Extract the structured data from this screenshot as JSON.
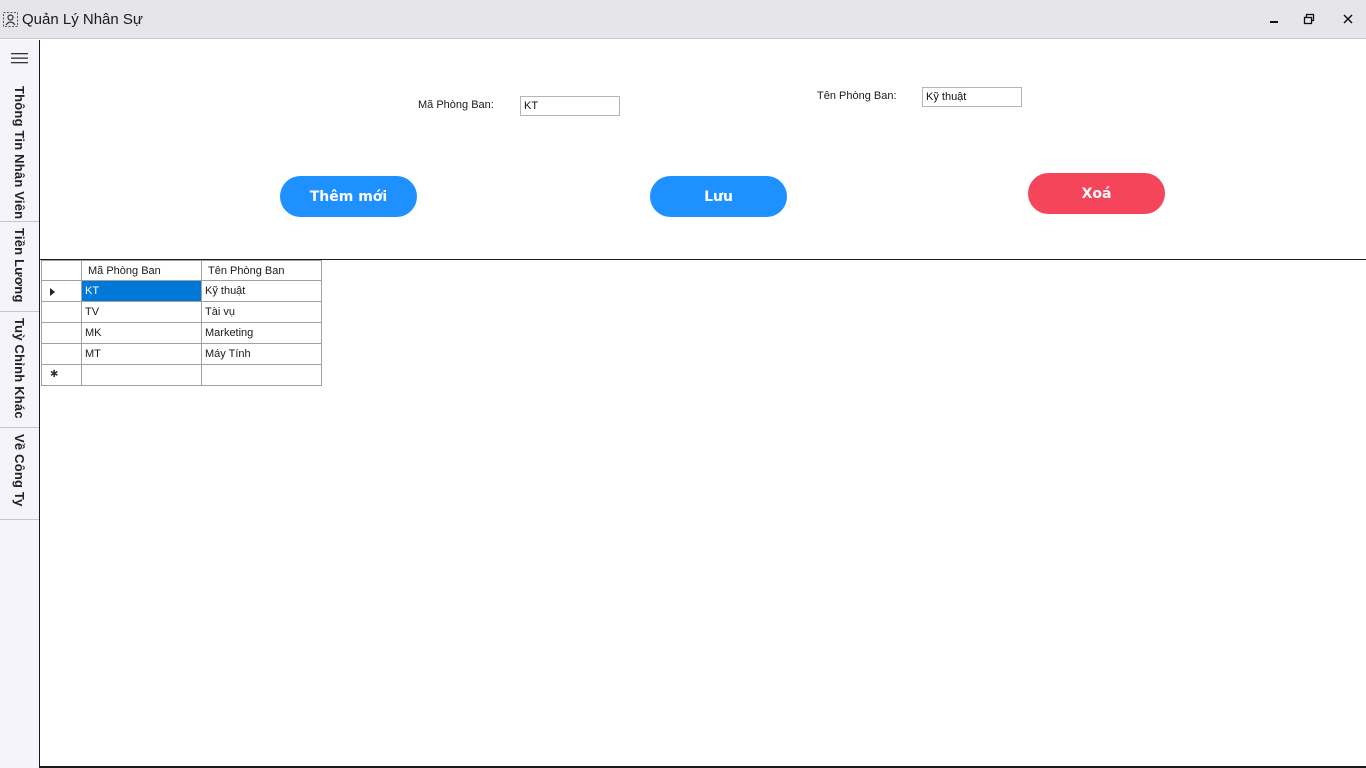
{
  "window": {
    "title": "Quản Lý Nhân Sự",
    "icons": {
      "app": "users-app-icon",
      "minimize": "minimize-icon",
      "restore": "restore-icon",
      "close": "close-icon"
    }
  },
  "sidebar": {
    "menu_icon": "hamburger-menu-icon",
    "items": [
      {
        "label": "Thông Tin Nhân Viên"
      },
      {
        "label": "Tiền Lương"
      },
      {
        "label": "Tuỳ Chỉnh Khác"
      },
      {
        "label": "Về Công Ty"
      }
    ]
  },
  "form": {
    "ma_label": "Mã Phòng Ban:",
    "ma_value": "KT",
    "ten_label": "Tên Phòng Ban:",
    "ten_value": "Kỹ thuật"
  },
  "buttons": {
    "add_label": "Thêm mới",
    "save_label": "Lưu",
    "delete_label": "Xoá",
    "colors": {
      "add": "#1e90ff",
      "save": "#1e90ff",
      "delete": "#f4455a"
    }
  },
  "table": {
    "columns": [
      "Mã Phòng Ban",
      "Tên Phòng Ban"
    ],
    "rows": [
      [
        "KT",
        "Kỹ thuật"
      ],
      [
        "TV",
        "Tài vụ"
      ],
      [
        "MK",
        "Marketing"
      ],
      [
        "MT",
        "Máy Tính"
      ]
    ],
    "selected_row": 0,
    "selection_color": "#0078d7"
  }
}
